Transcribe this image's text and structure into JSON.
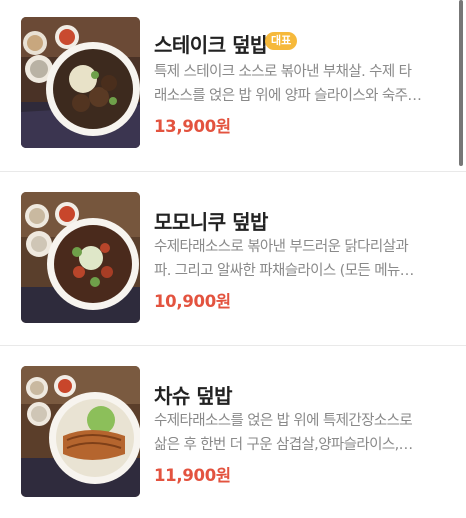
{
  "menu": {
    "items": [
      {
        "name": "스테이크 덮밥",
        "badge": "대표",
        "desc_line1": "특제 스테이크 소스로 볶아낸 부채살. 수제 타",
        "desc_line2": "래소스를 얹은 밥 위에 양파 슬라이스와 숙주…",
        "price": "13,900원",
        "image": "steak-rice-bowl-image"
      },
      {
        "name": "모모니쿠 덮밥",
        "desc_line1": "수제타래소스로 볶아낸 부드러운 닭다리살과",
        "desc_line2": "파. 그리고 알싸한 파채슬라이스 (모든 메뉴…",
        "price": "10,900원",
        "image": "chicken-thigh-rice-bowl-image"
      },
      {
        "name": "차슈 덮밥",
        "desc_line1": "수제타래소스를 얹은 밥 위에 특제간장소스로",
        "desc_line2": "삶은 후 한번 더 구운 삼겹살,양파슬라이스,…",
        "price": "11,900원",
        "image": "chashu-rice-bowl-image"
      }
    ]
  },
  "colors": {
    "price": "#e3533f",
    "badge": "#f6b93b",
    "title": "#222222",
    "description": "#8a8a8a"
  }
}
